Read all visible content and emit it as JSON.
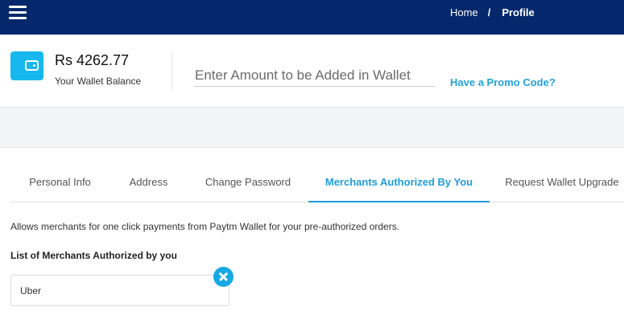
{
  "header": {
    "menu_icon": "hamburger-menu-icon",
    "breadcrumb": {
      "home": "Home",
      "separator": "/",
      "current": "Profile"
    },
    "background_color": "#04286b"
  },
  "wallet": {
    "icon": "wallet-icon",
    "balance": "Rs 4262.77",
    "balance_label": "Your Wallet Balance",
    "amount_placeholder": "Enter Amount to be Added in Wallet",
    "promo_link": "Have a Promo Code?",
    "accent_color": "#17b8ef"
  },
  "tabs": [
    {
      "label": "Personal Info",
      "active": false
    },
    {
      "label": "Address",
      "active": false
    },
    {
      "label": "Change Password",
      "active": false
    },
    {
      "label": "Merchants Authorized By You",
      "active": true
    },
    {
      "label": "Request Wallet Upgrade",
      "active": false
    }
  ],
  "merchants_section": {
    "description": "Allows merchants for one click payments from Paytm Wallet for your pre-authorized orders.",
    "list_title": "List of Merchants Authorized by you",
    "merchants": [
      {
        "name": "Uber",
        "remove_icon": "close-circle-icon"
      }
    ]
  }
}
